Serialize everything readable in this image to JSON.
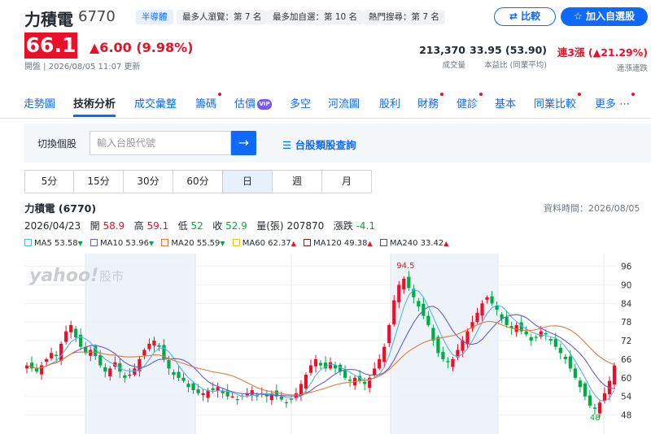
{
  "stock": {
    "name": "力積電",
    "code": "6770",
    "sector": "半導體",
    "rank_views": "最多人瀏覽：第 7 名",
    "rank_watch": "最多加自選：第 10 名",
    "rank_search": "熱門搜尋：第 7 名",
    "price": "66.1",
    "change": "▲6.00 (9.98%)",
    "status": "開盤 | 2026/08/05 11:07 更新"
  },
  "actions": {
    "compare": "比較",
    "watchlist": "加入自選股"
  },
  "stats": [
    {
      "value": "213,370",
      "label": "成交量"
    },
    {
      "value": "33.95 (53.90)",
      "label": "本益比 (同業平均)"
    },
    {
      "value": "連3漲 (▲21.29%)",
      "label": "連漲連跌"
    }
  ],
  "tabs": [
    "走勢圖",
    "技術分析",
    "成交彙整",
    "籌碼",
    "估價",
    "多空",
    "河流圖",
    "股利",
    "財務",
    "健診",
    "基本",
    "同業比較",
    "更多"
  ],
  "vip_label": "VIP",
  "search": {
    "label": "切換個股",
    "placeholder": "輸入台股代號",
    "link": "台股類股查詢"
  },
  "periods": [
    "5分",
    "15分",
    "30分",
    "60分",
    "日",
    "週",
    "月"
  ],
  "chart_header": {
    "title": "力積電 (6770)",
    "data_time": "資料時間：2026/08/05",
    "date": "2026/04/23",
    "open_label": "開",
    "open": "58.9",
    "high_label": "高",
    "high": "59.1",
    "low_label": "低",
    "low": "52",
    "close_label": "收",
    "close": "52.9",
    "volume_label": "量(張)",
    "volume": "207870",
    "change_label": "漲跌",
    "change": "-4.1"
  },
  "ma_legend": [
    {
      "name": "MA5",
      "value": "53.58",
      "dir": "down",
      "color": "#56b4e9"
    },
    {
      "name": "MA10",
      "value": "53.96",
      "dir": "down",
      "color": "#6a5acd"
    },
    {
      "name": "MA20",
      "value": "55.59",
      "dir": "down",
      "color": "#e07b39"
    },
    {
      "name": "MA60",
      "value": "62.37",
      "dir": "up",
      "color": "#f0c419"
    },
    {
      "name": "MA120",
      "value": "49.38",
      "dir": "up",
      "color": "#8b1a1a"
    },
    {
      "name": "MA240",
      "value": "33.42",
      "dir": "up",
      "color": "#555555"
    }
  ],
  "watermark": {
    "brand": "yahoo!",
    "suffix": "股市"
  },
  "colors": {
    "up": "#eb0f29",
    "down": "#00aa45",
    "accent": "#0f69ff"
  },
  "chart_data": {
    "type": "candlestick",
    "y_ticks": [
      96,
      90,
      84,
      78,
      72,
      66,
      60,
      54,
      48
    ],
    "ylim": [
      45,
      98
    ],
    "max_label": "94.5",
    "min_label": "48",
    "closes": [
      64,
      63,
      62,
      64,
      66,
      68,
      67,
      71,
      75,
      77,
      73,
      70,
      68,
      69,
      67,
      64,
      62,
      63,
      65,
      62,
      60,
      61,
      63,
      66,
      69,
      71,
      72,
      70,
      66,
      63,
      61,
      60,
      59,
      57,
      56,
      55,
      55,
      56,
      56,
      57,
      55,
      54,
      54,
      53,
      54,
      55,
      56,
      54,
      55,
      54,
      55,
      54,
      53,
      52,
      53,
      55,
      58,
      61,
      64,
      66,
      64,
      63,
      65,
      63,
      62,
      60,
      59,
      60,
      59,
      58,
      60,
      63,
      66,
      70,
      77,
      85,
      90,
      92,
      89,
      86,
      83,
      80,
      77,
      72,
      68,
      66,
      65,
      66,
      69,
      72,
      75,
      78,
      81,
      84,
      86,
      84,
      82,
      79,
      77,
      76,
      77,
      75,
      74,
      72,
      73,
      75,
      74,
      72,
      70,
      68,
      66,
      63,
      60,
      57,
      54,
      51,
      50,
      52,
      55,
      59,
      64
    ]
  }
}
